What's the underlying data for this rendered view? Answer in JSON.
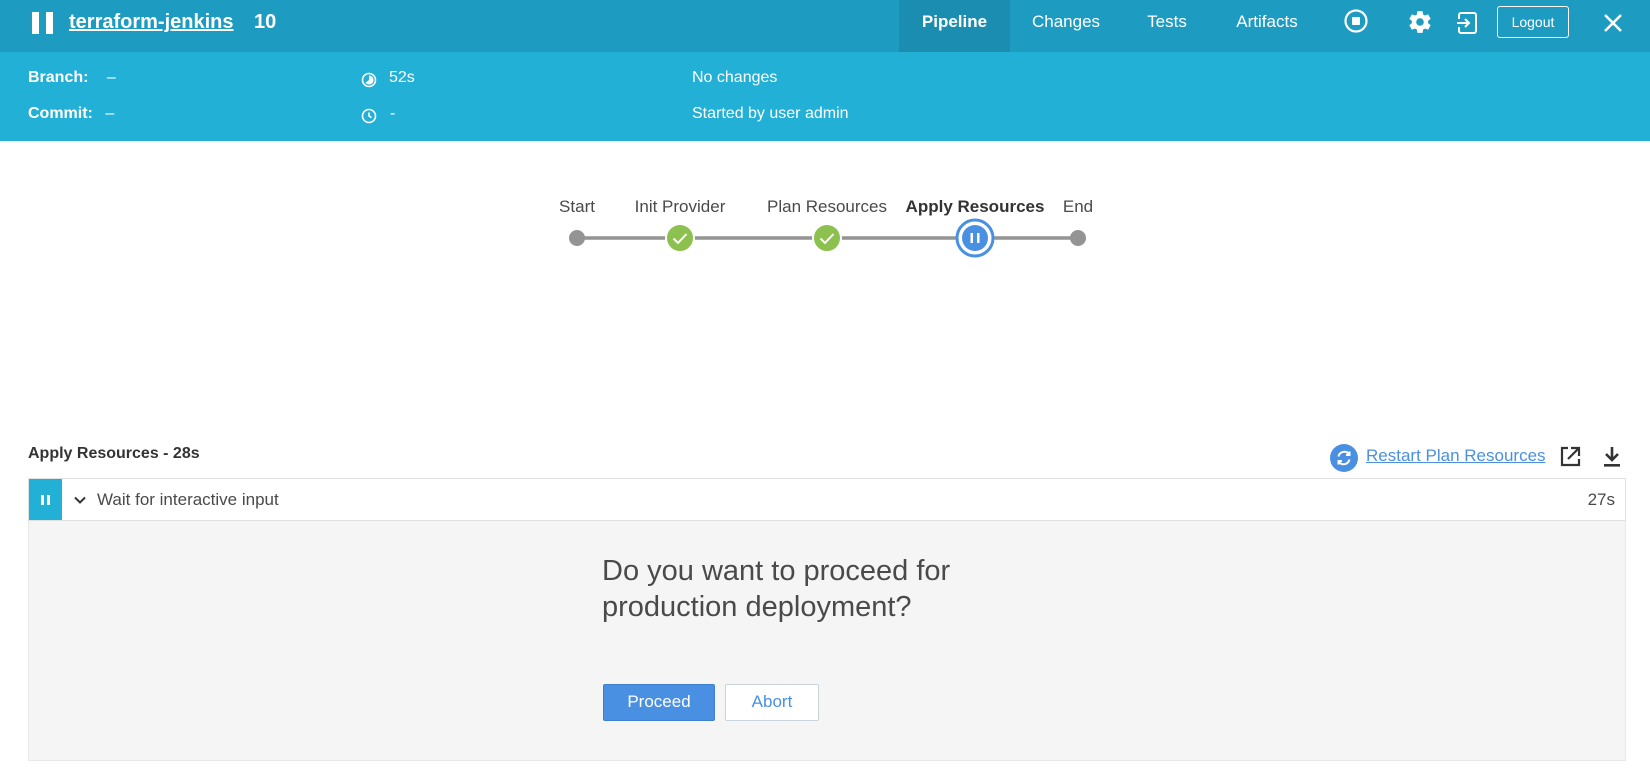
{
  "header": {
    "job_name": "terraform-jenkins",
    "run_number": "10",
    "tabs": [
      {
        "label": "Pipeline",
        "active": true
      },
      {
        "label": "Changes",
        "active": false
      },
      {
        "label": "Tests",
        "active": false
      },
      {
        "label": "Artifacts",
        "active": false
      }
    ],
    "logout_label": "Logout",
    "icons": [
      "pause-icon",
      "stop-icon",
      "gear-icon",
      "exit-icon",
      "close-icon"
    ]
  },
  "info": {
    "branch_label": "Branch:",
    "branch_value": "–",
    "commit_label": "Commit:",
    "commit_value": "–",
    "duration": "52s",
    "time": "-",
    "changes": "No changes",
    "started_by": "Started by user admin"
  },
  "pipeline": {
    "stages": [
      {
        "label": "Start",
        "status": "start"
      },
      {
        "label": "Init Provider",
        "status": "success"
      },
      {
        "label": "Plan Resources",
        "status": "success"
      },
      {
        "label": "Apply Resources",
        "status": "paused"
      },
      {
        "label": "End",
        "status": "end"
      }
    ],
    "colors": {
      "success": "#8cc04f",
      "paused": "#4a90e2",
      "node": "#949494",
      "line": "#949494"
    }
  },
  "log": {
    "section_title": "Apply Resources - 28s",
    "restart_label": "Restart Plan Resources",
    "step": {
      "label": "Wait for interactive input",
      "duration": "27s"
    },
    "input": {
      "question": "Do you want to proceed for production deployment?",
      "proceed_label": "Proceed",
      "abort_label": "Abort"
    }
  }
}
